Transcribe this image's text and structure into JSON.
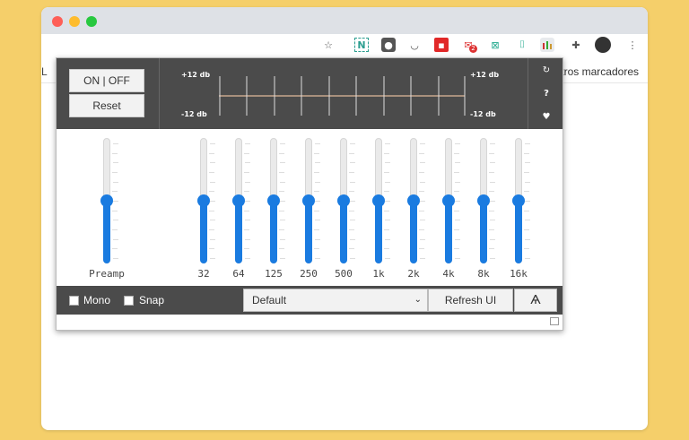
{
  "colors": {
    "accent": "#1a7be0",
    "panel": "#4b4b4b",
    "background": "#f5cf6a"
  },
  "toolbar": {
    "icons": [
      "star-icon",
      "notion-icon",
      "shield-icon",
      "pocket-icon",
      "flipboard-icon",
      "mail-icon",
      "extension-green-icon",
      "equalizer-icon",
      "puzzle-icon",
      "avatar",
      "more-icon"
    ],
    "mail_badge": "2"
  },
  "bookmarks": {
    "left": "L",
    "right": "Otros marcadores"
  },
  "eq": {
    "onoff_label": "ON | OFF",
    "reset_label": "Reset",
    "db_top_left": "+12 db",
    "db_bottom_left": "-12 db",
    "db_top_right": "+12 db",
    "db_bottom_right": "-12 db",
    "side_icons": [
      "refresh-icon",
      "help-icon",
      "heart-icon"
    ],
    "preamp_label": "Preamp",
    "preamp_level": 0.5,
    "bands": [
      {
        "label": "32",
        "level": 0.5
      },
      {
        "label": "64",
        "level": 0.5
      },
      {
        "label": "125",
        "level": 0.5
      },
      {
        "label": "250",
        "level": 0.5
      },
      {
        "label": "500",
        "level": 0.5
      },
      {
        "label": "1k",
        "level": 0.5
      },
      {
        "label": "2k",
        "level": 0.5
      },
      {
        "label": "4k",
        "level": 0.5
      },
      {
        "label": "8k",
        "level": 0.5
      },
      {
        "label": "16k",
        "level": 0.5
      }
    ],
    "mono_label": "Mono",
    "snap_label": "Snap",
    "preset_selected": "Default",
    "refresh_label": "Refresh UI",
    "pin_glyph": "Ѧ"
  }
}
